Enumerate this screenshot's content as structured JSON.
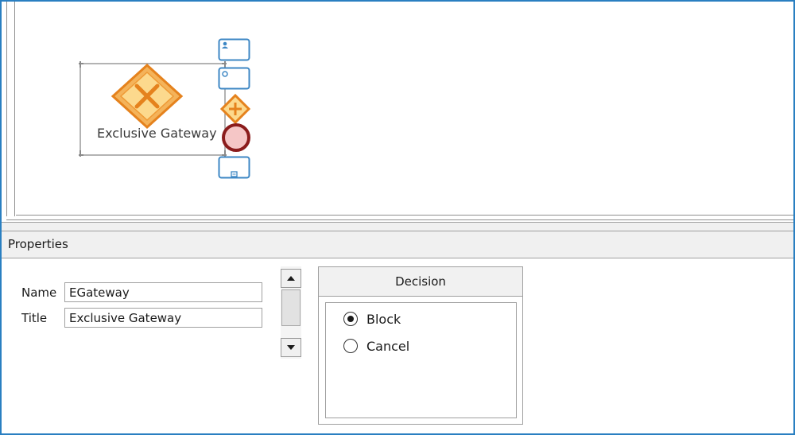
{
  "canvas": {
    "element": {
      "label": "Exclusive Gateway",
      "icon": "exclusive-gateway-icon",
      "colors": {
        "gateway_fill": "#fbd78a",
        "gateway_stroke": "#e5821d"
      }
    },
    "toolbox": [
      {
        "name": "user-task-icon"
      },
      {
        "name": "service-task-icon"
      },
      {
        "name": "parallel-gateway-icon"
      },
      {
        "name": "end-event-icon"
      },
      {
        "name": "subprocess-icon"
      }
    ]
  },
  "properties": {
    "header": "Properties",
    "fields": [
      {
        "label": "Name",
        "value": "EGateway"
      },
      {
        "label": "Title",
        "value": "Exclusive Gateway"
      }
    ],
    "decision": {
      "title": "Decision",
      "options": [
        {
          "label": "Block",
          "checked": true
        },
        {
          "label": "Cancel",
          "checked": false
        }
      ]
    }
  },
  "colors": {
    "frame_border": "#2a7fc1",
    "task_blue": "#3d87c4"
  }
}
